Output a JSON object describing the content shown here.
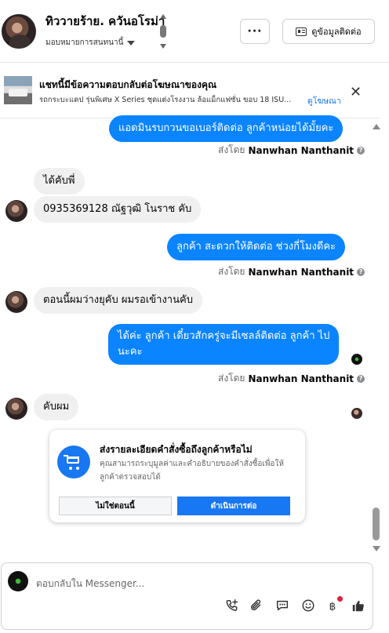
{
  "header": {
    "contact_name": "ทิววายร้าย. ควันอโรม่า",
    "assign_label": "มอบหมายการสนทนานี้",
    "more_label": "···",
    "contact_info_label": "ดูข้อมูลติดต่อ"
  },
  "ad_banner": {
    "title": "แชทนี้มีข้อความตอบกลับต่อโฆษณาของคุณ",
    "subtitle": "รถกระบะแคป รุ่นพิเศษ X Series ชุดแต่งโรงงาน ล้อแม็กแฟซั่น ขอบ 18 ISU...",
    "link": "ดูโฆษณา",
    "close": "✕"
  },
  "messages": [
    {
      "direction": "out",
      "text": "แอดมินรบกวนขอเบอร์ติดต่อ ลูกค้าหน่อยได้มั้ยคะ"
    },
    {
      "direction": "in",
      "text": "ได้คับพี่"
    },
    {
      "direction": "in",
      "text": "0935369128 ณัฐวุฒิ โนราช คับ"
    },
    {
      "direction": "out",
      "text": "ลูกค้า สะดวกให้ติดต่อ ช่วงกี่โมงดีคะ"
    },
    {
      "direction": "in",
      "text": "ตอนนี้ผมว่างยุคับ ผมรอเข้างานคับ"
    },
    {
      "direction": "out",
      "text_line1": "ได้ค่ะ ลูกค้า เดี๋ยวสักครู่จะมีเซลล์ติดต่อ ลูกค้า ไป",
      "text_line2": "นะคะ"
    },
    {
      "direction": "in",
      "text": "คับผม"
    }
  ],
  "sent_by": {
    "prefix": "ส่งโดย",
    "name": "Nanwhan Nanthanit",
    "help": "?"
  },
  "order_card": {
    "title": "ส่งรายละเอียดคำสั่งซื้อถึงลูกค้าหรือไม่",
    "description": "คุณสามารถระบุมูลค่าและคำอธิบายของคำสั่งซื้อเพื่อให้ลูกค้าตรวจสอบได้",
    "decline_label": "ไม่ใช่ตอนนี้",
    "continue_label": "ดำเนินการต่อ"
  },
  "composer": {
    "placeholder": "ตอบกลับใน Messenger...",
    "tools": [
      "call-add-icon",
      "attachment-icon",
      "saved-replies-icon",
      "emoji-icon",
      "baht-payment-icon",
      "like-icon"
    ]
  },
  "colors": {
    "outgoing_bubble": "#0b84ff",
    "incoming_bubble": "#f0f0f0",
    "accent": "#1877f2"
  }
}
